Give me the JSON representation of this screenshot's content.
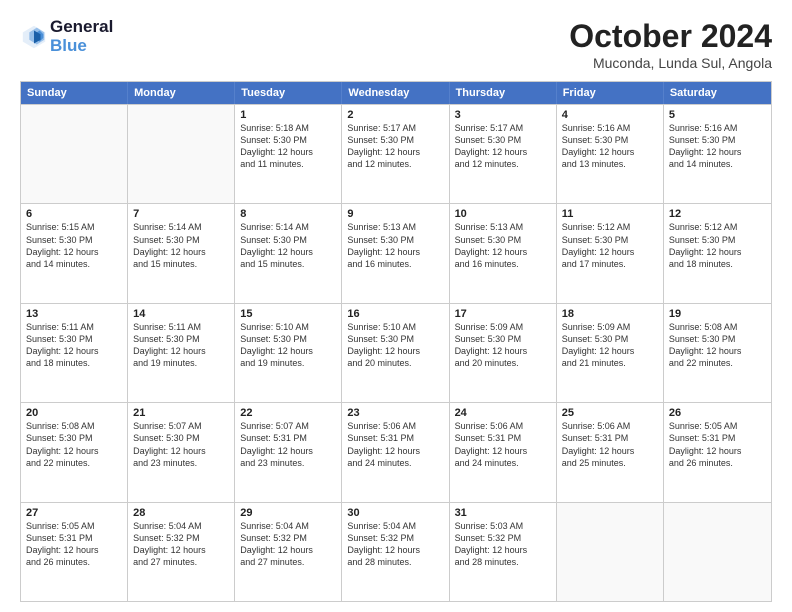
{
  "header": {
    "logo_line1": "General",
    "logo_line2": "Blue",
    "month": "October 2024",
    "location": "Muconda, Lunda Sul, Angola"
  },
  "weekdays": [
    "Sunday",
    "Monday",
    "Tuesday",
    "Wednesday",
    "Thursday",
    "Friday",
    "Saturday"
  ],
  "rows": [
    [
      {
        "day": "",
        "info": ""
      },
      {
        "day": "",
        "info": ""
      },
      {
        "day": "1",
        "info": "Sunrise: 5:18 AM\nSunset: 5:30 PM\nDaylight: 12 hours\nand 11 minutes."
      },
      {
        "day": "2",
        "info": "Sunrise: 5:17 AM\nSunset: 5:30 PM\nDaylight: 12 hours\nand 12 minutes."
      },
      {
        "day": "3",
        "info": "Sunrise: 5:17 AM\nSunset: 5:30 PM\nDaylight: 12 hours\nand 12 minutes."
      },
      {
        "day": "4",
        "info": "Sunrise: 5:16 AM\nSunset: 5:30 PM\nDaylight: 12 hours\nand 13 minutes."
      },
      {
        "day": "5",
        "info": "Sunrise: 5:16 AM\nSunset: 5:30 PM\nDaylight: 12 hours\nand 14 minutes."
      }
    ],
    [
      {
        "day": "6",
        "info": "Sunrise: 5:15 AM\nSunset: 5:30 PM\nDaylight: 12 hours\nand 14 minutes."
      },
      {
        "day": "7",
        "info": "Sunrise: 5:14 AM\nSunset: 5:30 PM\nDaylight: 12 hours\nand 15 minutes."
      },
      {
        "day": "8",
        "info": "Sunrise: 5:14 AM\nSunset: 5:30 PM\nDaylight: 12 hours\nand 15 minutes."
      },
      {
        "day": "9",
        "info": "Sunrise: 5:13 AM\nSunset: 5:30 PM\nDaylight: 12 hours\nand 16 minutes."
      },
      {
        "day": "10",
        "info": "Sunrise: 5:13 AM\nSunset: 5:30 PM\nDaylight: 12 hours\nand 16 minutes."
      },
      {
        "day": "11",
        "info": "Sunrise: 5:12 AM\nSunset: 5:30 PM\nDaylight: 12 hours\nand 17 minutes."
      },
      {
        "day": "12",
        "info": "Sunrise: 5:12 AM\nSunset: 5:30 PM\nDaylight: 12 hours\nand 18 minutes."
      }
    ],
    [
      {
        "day": "13",
        "info": "Sunrise: 5:11 AM\nSunset: 5:30 PM\nDaylight: 12 hours\nand 18 minutes."
      },
      {
        "day": "14",
        "info": "Sunrise: 5:11 AM\nSunset: 5:30 PM\nDaylight: 12 hours\nand 19 minutes."
      },
      {
        "day": "15",
        "info": "Sunrise: 5:10 AM\nSunset: 5:30 PM\nDaylight: 12 hours\nand 19 minutes."
      },
      {
        "day": "16",
        "info": "Sunrise: 5:10 AM\nSunset: 5:30 PM\nDaylight: 12 hours\nand 20 minutes."
      },
      {
        "day": "17",
        "info": "Sunrise: 5:09 AM\nSunset: 5:30 PM\nDaylight: 12 hours\nand 20 minutes."
      },
      {
        "day": "18",
        "info": "Sunrise: 5:09 AM\nSunset: 5:30 PM\nDaylight: 12 hours\nand 21 minutes."
      },
      {
        "day": "19",
        "info": "Sunrise: 5:08 AM\nSunset: 5:30 PM\nDaylight: 12 hours\nand 22 minutes."
      }
    ],
    [
      {
        "day": "20",
        "info": "Sunrise: 5:08 AM\nSunset: 5:30 PM\nDaylight: 12 hours\nand 22 minutes."
      },
      {
        "day": "21",
        "info": "Sunrise: 5:07 AM\nSunset: 5:30 PM\nDaylight: 12 hours\nand 23 minutes."
      },
      {
        "day": "22",
        "info": "Sunrise: 5:07 AM\nSunset: 5:31 PM\nDaylight: 12 hours\nand 23 minutes."
      },
      {
        "day": "23",
        "info": "Sunrise: 5:06 AM\nSunset: 5:31 PM\nDaylight: 12 hours\nand 24 minutes."
      },
      {
        "day": "24",
        "info": "Sunrise: 5:06 AM\nSunset: 5:31 PM\nDaylight: 12 hours\nand 24 minutes."
      },
      {
        "day": "25",
        "info": "Sunrise: 5:06 AM\nSunset: 5:31 PM\nDaylight: 12 hours\nand 25 minutes."
      },
      {
        "day": "26",
        "info": "Sunrise: 5:05 AM\nSunset: 5:31 PM\nDaylight: 12 hours\nand 26 minutes."
      }
    ],
    [
      {
        "day": "27",
        "info": "Sunrise: 5:05 AM\nSunset: 5:31 PM\nDaylight: 12 hours\nand 26 minutes."
      },
      {
        "day": "28",
        "info": "Sunrise: 5:04 AM\nSunset: 5:32 PM\nDaylight: 12 hours\nand 27 minutes."
      },
      {
        "day": "29",
        "info": "Sunrise: 5:04 AM\nSunset: 5:32 PM\nDaylight: 12 hours\nand 27 minutes."
      },
      {
        "day": "30",
        "info": "Sunrise: 5:04 AM\nSunset: 5:32 PM\nDaylight: 12 hours\nand 28 minutes."
      },
      {
        "day": "31",
        "info": "Sunrise: 5:03 AM\nSunset: 5:32 PM\nDaylight: 12 hours\nand 28 minutes."
      },
      {
        "day": "",
        "info": ""
      },
      {
        "day": "",
        "info": ""
      }
    ]
  ]
}
